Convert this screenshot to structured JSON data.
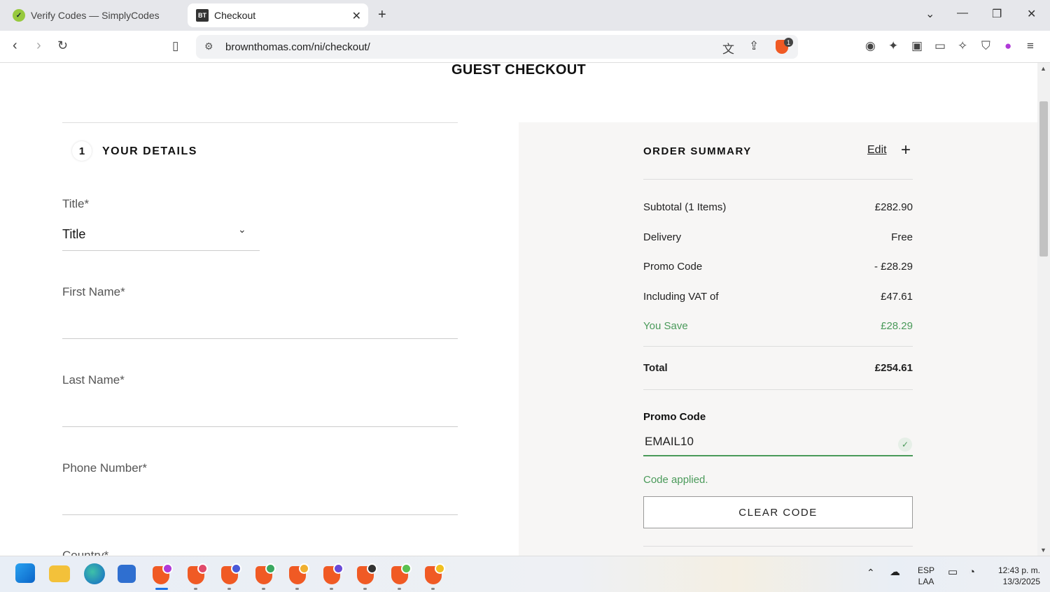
{
  "browser": {
    "tabs": [
      {
        "label": "Verify Codes — SimplyCodes",
        "icon": "simplycodes-icon"
      },
      {
        "label": "Checkout",
        "icon": "bt-icon"
      }
    ],
    "url": "brownthomas.com/ni/checkout/",
    "shield_badge": "1"
  },
  "page": {
    "title": "GUEST CHECKOUT",
    "step_number": "1",
    "step_title": "YOUR DETAILS",
    "fields": {
      "title_label": "Title*",
      "title_value": "Title",
      "first_name_label": "First Name*",
      "last_name_label": "Last Name*",
      "phone_label": "Phone Number*",
      "country_label": "Country*"
    }
  },
  "summary": {
    "title": "ORDER SUMMARY",
    "edit_label": "Edit",
    "rows": [
      {
        "label": "Subtotal (1 Items)",
        "value": "£282.90"
      },
      {
        "label": "Delivery",
        "value": "Free"
      },
      {
        "label": "Promo Code",
        "value": "- £28.29"
      },
      {
        "label": "Including VAT of",
        "value": "£47.61"
      },
      {
        "label": "You Save",
        "value": "£28.29"
      }
    ],
    "total_label": "Total",
    "total_value": "£254.61",
    "promo_label": "Promo Code",
    "promo_value": "EMAIL10",
    "promo_message": "Code applied.",
    "clear_button": "CLEAR CODE"
  },
  "taskbar": {
    "language": "ESP",
    "layout": "LAA",
    "time": "12:43 p. m.",
    "date": "13/3/2025"
  },
  "colors": {
    "accent_green": "#4a9a5a",
    "summary_bg": "#f7f6f5",
    "brave_orange": "#f05a24"
  }
}
